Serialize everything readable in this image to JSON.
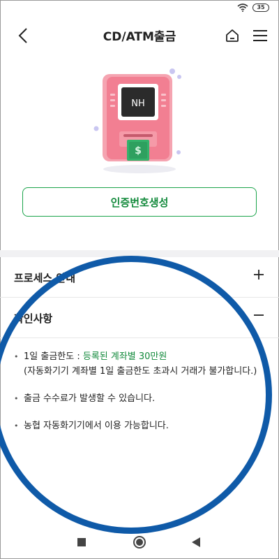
{
  "status_bar": {
    "battery": "35",
    "wifi_icon": "wifi-icon"
  },
  "header": {
    "title": "CD/ATM출금",
    "back_icon": "chevron-left-icon",
    "home_icon": "home-icon",
    "menu_icon": "hamburger-menu-icon"
  },
  "illustration": {
    "screen_label": "NH",
    "machine_color": "#f27f92",
    "cash_color": "#34b36b"
  },
  "primary_button": {
    "label": "인증번호생성",
    "accent": "#1aa34a"
  },
  "accordion": [
    {
      "title": "프로세스 안내",
      "sign": "+"
    },
    {
      "title": "확인사항",
      "sign": "−"
    }
  ],
  "notes": [
    {
      "prefix": "1일 출금한도 : ",
      "highlight": "등록된 계좌별 30만원",
      "detail": "(자동화기기 계좌별 1일 출금한도 초과시 거래가 불가합니다.)"
    },
    {
      "text": "출금 수수료가 발생할 수 있습니다."
    },
    {
      "text": "농협 자동화기기에서 이용 가능합니다."
    }
  ],
  "overlay": {
    "color": "#0f5aa8"
  },
  "nav": {
    "recent_icon": "square-icon",
    "home_icon": "circle-home-icon",
    "back_icon": "triangle-back-icon"
  }
}
